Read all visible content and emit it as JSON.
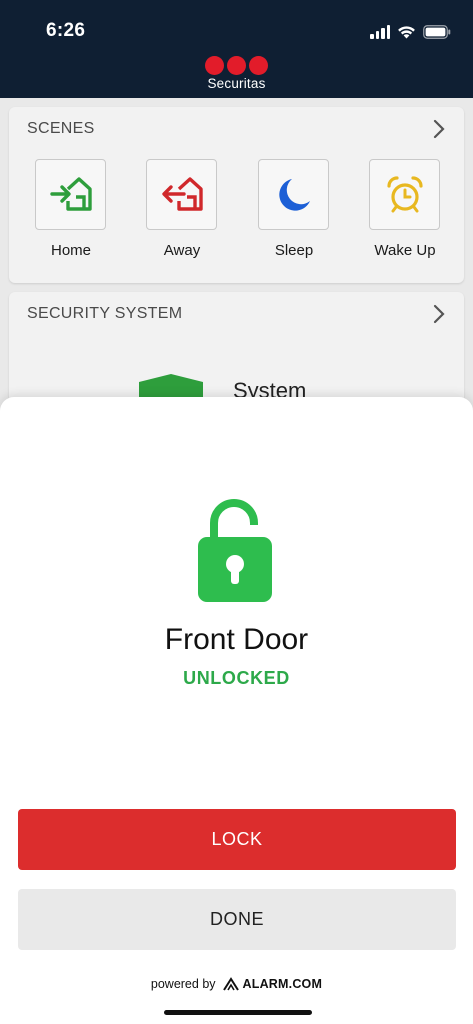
{
  "status_bar": {
    "time": "6:26"
  },
  "brand": {
    "name": "Securitas",
    "color": "#e21c2a"
  },
  "scenes": {
    "title": "SCENES",
    "items": [
      {
        "label": "Home",
        "icon": "home-arrive-icon",
        "color": "#2e9e3c"
      },
      {
        "label": "Away",
        "icon": "home-leave-icon",
        "color": "#d0282b"
      },
      {
        "label": "Sleep",
        "icon": "moon-icon",
        "color": "#1c5fd6"
      },
      {
        "label": "Wake Up",
        "icon": "alarm-clock-icon",
        "color": "#e8b820"
      }
    ]
  },
  "security_system": {
    "title": "SECURITY SYSTEM",
    "status_partial": "System"
  },
  "device_sheet": {
    "name": "Front Door",
    "state": "UNLOCKED",
    "state_color": "#2da94a",
    "lock_button": "LOCK",
    "done_button": "DONE",
    "powered_by": "powered by",
    "provider": "ALARM.COM"
  }
}
